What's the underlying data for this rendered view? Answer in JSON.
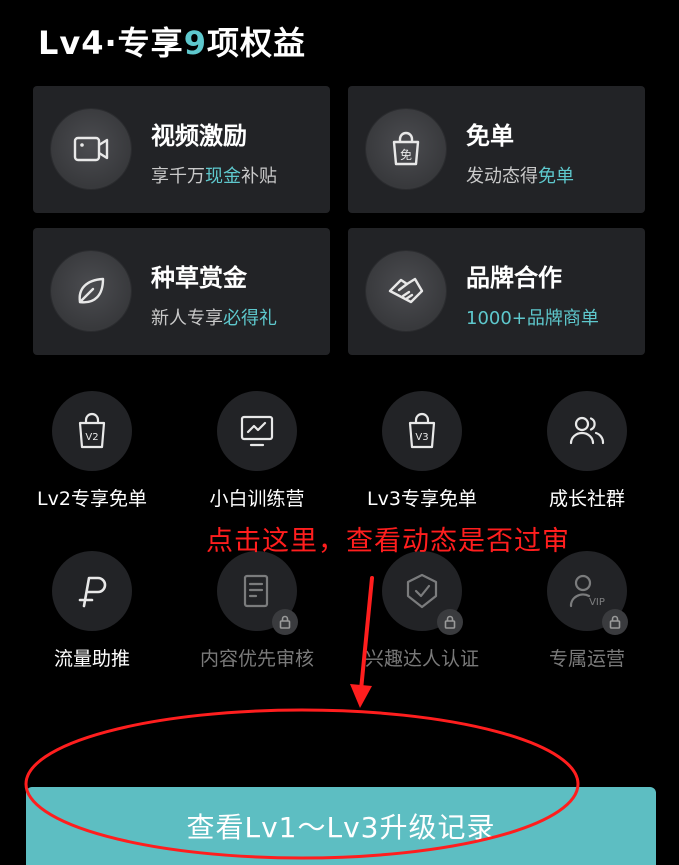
{
  "header": {
    "title_prefix": "Lv4·专享",
    "title_count": "9",
    "title_suffix": "项权益"
  },
  "cards": [
    {
      "title": "视频激励",
      "sub_a": "享千万",
      "sub_hl": "现金",
      "sub_b": "补贴",
      "icon": "video-camera-icon"
    },
    {
      "title": "免单",
      "sub_a": "发动态得",
      "sub_hl": "免单",
      "sub_b": "",
      "icon": "shopping-bag-free-icon"
    },
    {
      "title": "种草赏金",
      "sub_a": "新人专享",
      "sub_hl": "必得礼",
      "sub_b": "",
      "icon": "leaf-icon"
    },
    {
      "title": "品牌合作",
      "sub_full": "1000+品牌商单",
      "icon": "handshake-icon"
    }
  ],
  "grid": [
    {
      "label": "Lv2专享免单",
      "badge": "V2",
      "icon": "bag-v2-icon",
      "locked": false
    },
    {
      "label": "小白训练营",
      "icon": "monitor-chart-icon",
      "locked": false
    },
    {
      "label": "Lv3专享免单",
      "badge": "V3",
      "icon": "bag-v3-icon",
      "locked": false
    },
    {
      "label": "成长社群",
      "icon": "users-icon",
      "locked": false
    },
    {
      "label": "流量助推",
      "icon": "boost-icon",
      "locked": false
    },
    {
      "label": "内容优先审核",
      "icon": "review-document-icon",
      "locked": true
    },
    {
      "label": "兴趣达人认证",
      "icon": "shield-check-icon",
      "locked": true
    },
    {
      "label": "专属运营",
      "badge": "VIP",
      "icon": "vip-operator-icon",
      "locked": true
    }
  ],
  "annotation": "点击这里，查看动态是否过审",
  "cta_label": "查看Lv1～Lv3升级记录",
  "colors": {
    "accent": "#5ec8cd",
    "annotation": "#ff1e1e",
    "cta_bg": "#5dbec2",
    "card_bg": "#222326"
  }
}
